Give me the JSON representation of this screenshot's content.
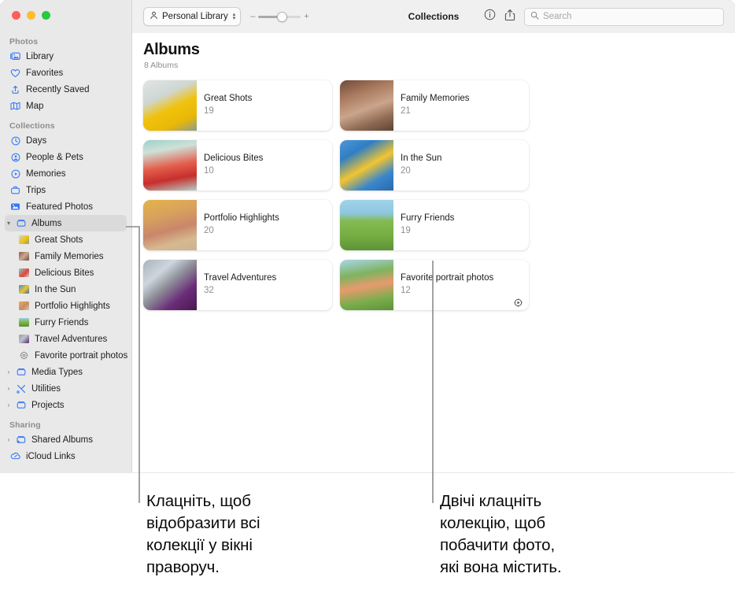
{
  "window": {
    "traffic_lights": [
      "close",
      "minimize",
      "zoom"
    ]
  },
  "toolbar": {
    "library_label": "Personal Library",
    "zoom_minus": "–",
    "zoom_plus": "+",
    "title": "Collections",
    "info_icon": "info-icon",
    "share_icon": "share-icon",
    "search_placeholder": "Search",
    "search_value": ""
  },
  "sidebar": {
    "sections": [
      {
        "label": "Photos",
        "items": [
          {
            "label": "Library",
            "icon": "library-icon"
          },
          {
            "label": "Favorites",
            "icon": "heart-icon"
          },
          {
            "label": "Recently Saved",
            "icon": "recently-saved-icon"
          },
          {
            "label": "Map",
            "icon": "map-icon"
          }
        ]
      },
      {
        "label": "Collections",
        "items": [
          {
            "label": "Days",
            "icon": "clock-icon"
          },
          {
            "label": "People & Pets",
            "icon": "person-circle-icon"
          },
          {
            "label": "Memories",
            "icon": "memories-icon"
          },
          {
            "label": "Trips",
            "icon": "suitcase-icon"
          },
          {
            "label": "Featured Photos",
            "icon": "featured-photos-icon"
          },
          {
            "label": "Albums",
            "icon": "album-icon",
            "selected": true,
            "expanded": true,
            "children": [
              {
                "label": "Great Shots",
                "icon": "album-thumb"
              },
              {
                "label": "Family Memories",
                "icon": "album-thumb"
              },
              {
                "label": "Delicious Bites",
                "icon": "album-thumb"
              },
              {
                "label": "In the Sun",
                "icon": "album-thumb"
              },
              {
                "label": "Portfolio Highlights",
                "icon": "album-thumb"
              },
              {
                "label": "Furry Friends",
                "icon": "album-thumb"
              },
              {
                "label": "Travel Adventures",
                "icon": "album-thumb"
              },
              {
                "label": "Favorite portrait photos",
                "icon": "gear-icon"
              }
            ]
          },
          {
            "label": "Media Types",
            "icon": "album-icon",
            "collapsed": true
          },
          {
            "label": "Utilities",
            "icon": "utilities-icon",
            "collapsed": true
          },
          {
            "label": "Projects",
            "icon": "album-icon",
            "collapsed": true
          }
        ]
      },
      {
        "label": "Sharing",
        "items": [
          {
            "label": "Shared Albums",
            "icon": "shared-album-icon",
            "collapsed": true
          },
          {
            "label": "iCloud Links",
            "icon": "icloud-link-icon"
          }
        ]
      }
    ]
  },
  "main": {
    "title": "Albums",
    "subtitle": "8 Albums",
    "albums": [
      {
        "title": "Great Shots",
        "count": "19",
        "colors": [
          "#cdd6d8",
          "#f2c20a",
          "#8a9aa0"
        ]
      },
      {
        "title": "Family Memories",
        "count": "21",
        "colors": [
          "#8e5b45",
          "#c9a892",
          "#6d4b3c"
        ]
      },
      {
        "title": "Delicious Bites",
        "count": "10",
        "colors": [
          "#8fc9c2",
          "#e0443e",
          "#c8d8d2"
        ]
      },
      {
        "title": "In the Sun",
        "count": "20",
        "colors": [
          "#3d8fd6",
          "#f0c330",
          "#2d6fae"
        ]
      },
      {
        "title": "Portfolio Highlights",
        "count": "20",
        "colors": [
          "#e2b24c",
          "#c98a6a",
          "#d9c7a4"
        ]
      },
      {
        "title": "Furry Friends",
        "count": "19",
        "colors": [
          "#7fb84a",
          "#d7bc7a",
          "#9ccfe8"
        ]
      },
      {
        "title": "Travel Adventures",
        "count": "32",
        "colors": [
          "#9a9ea6",
          "#5a2466",
          "#b9c3cc"
        ]
      },
      {
        "title": "Favorite portrait photos",
        "count": "12",
        "smart": true,
        "badge_icon": "smart-album-icon",
        "colors": [
          "#6fa83f",
          "#e8936a",
          "#9fd3e8"
        ]
      }
    ]
  },
  "callouts": [
    {
      "text": "Клацніть, щоб\nвідобразити всі\nколекції у вікні\nправоруч."
    },
    {
      "text": "Двічі клацніть\nколекцію, щоб\nпобачити фото,\nякі вона містить."
    }
  ],
  "colors": {
    "accent": "#3478f6",
    "sidebar_bg": "#e9e9e9",
    "toolbar_bg": "#f0f0f0",
    "selected_row": "#dadada",
    "leader_line": "#8a8a8a"
  }
}
